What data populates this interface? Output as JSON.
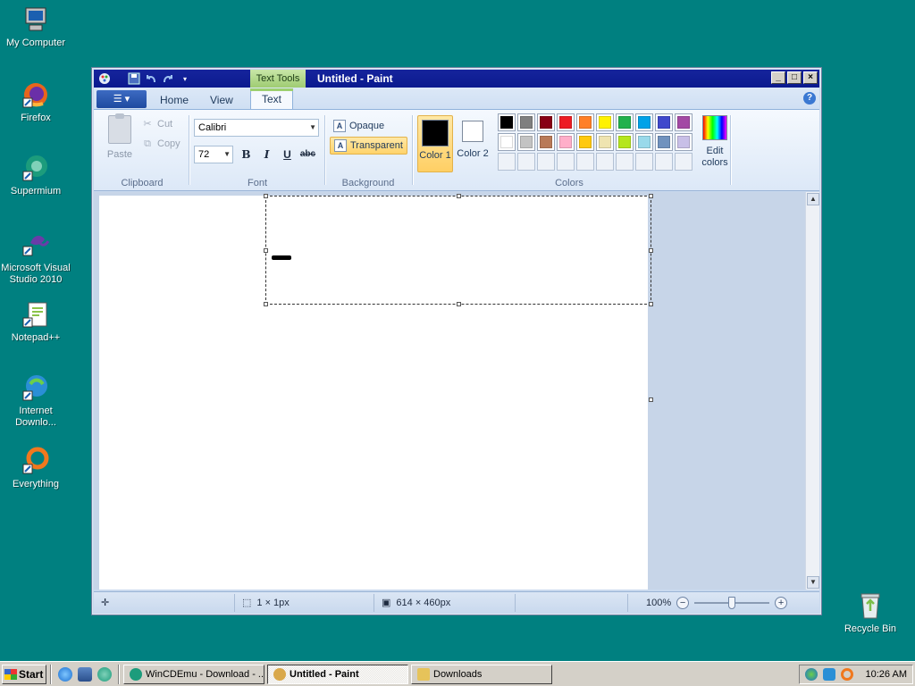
{
  "desktop": {
    "icons": [
      {
        "label": "My Computer",
        "icon": "computer-icon",
        "color": "#5a87c5"
      },
      {
        "label": "Firefox",
        "icon": "firefox-icon",
        "color": "#e8651c"
      },
      {
        "label": "Supermium",
        "icon": "supermium-icon",
        "color": "#1c9c7c"
      },
      {
        "label": "Microsoft Visual Studio 2010",
        "icon": "visual-studio-icon",
        "color": "#6a3ca8"
      },
      {
        "label": "Notepad++",
        "icon": "notepadpp-icon",
        "color": "#8bc34a"
      },
      {
        "label": "Internet Downlo...",
        "icon": "idm-icon",
        "color": "#2a8fd6"
      },
      {
        "label": "Everything",
        "icon": "everything-icon",
        "color": "#f0781e"
      },
      {
        "label": "Recycle Bin",
        "icon": "recycle-bin-icon",
        "color": "#7cbf4a"
      }
    ]
  },
  "window": {
    "title": "Untitled - Paint",
    "context_tab": "Text Tools",
    "controls": {
      "minimize": "_",
      "maximize": "□",
      "close": "×"
    }
  },
  "ribbon": {
    "tabs": [
      {
        "label": "Home"
      },
      {
        "label": "View"
      },
      {
        "label": "Text"
      }
    ],
    "active_tab": "Text",
    "clipboard": {
      "paste": "Paste",
      "cut": "Cut",
      "copy": "Copy",
      "group": "Clipboard"
    },
    "font": {
      "family": "Calibri",
      "size": "72",
      "bold": "B",
      "italic": "I",
      "underline": "U",
      "strike": "abc",
      "group": "Font"
    },
    "background": {
      "opaque": "Opaque",
      "transparent": "Transparent",
      "group": "Background"
    },
    "colors": {
      "color1_label": "Color 1",
      "color1": "#000000",
      "color2_label": "Color 2",
      "color2": "#ffffff",
      "group": "Colors",
      "edit_label": "Edit colors",
      "palette_row1": [
        "#000000",
        "#7f7f7f",
        "#880015",
        "#ed1c24",
        "#ff7f27",
        "#fff200",
        "#22b14c",
        "#00a2e8",
        "#3f48cc",
        "#a349a4"
      ],
      "palette_row2": [
        "#ffffff",
        "#c3c3c3",
        "#b97a57",
        "#ffaec9",
        "#ffc90e",
        "#efe4b0",
        "#b5e61d",
        "#99d9ea",
        "#7092be",
        "#c8bfe7"
      ]
    }
  },
  "statusbar": {
    "selection": "1 × 1px",
    "canvas_size": "614 × 460px",
    "zoom": "100%"
  },
  "taskbar": {
    "start": "Start",
    "tasks": [
      {
        "label": "WinCDEmu - Download - ...",
        "color": "#1c9c7c"
      },
      {
        "label": "Untitled - Paint",
        "color": "#d9a84a"
      },
      {
        "label": "Downloads",
        "color": "#e6c35a"
      }
    ],
    "clock": "10:26 AM"
  }
}
